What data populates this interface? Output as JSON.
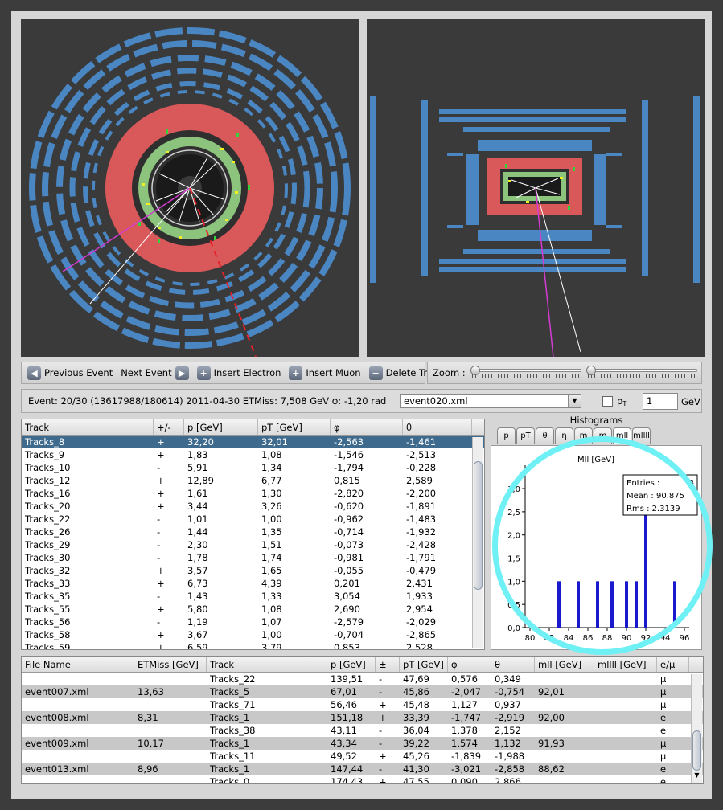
{
  "toolbar": {
    "prev_label": "Previous Event",
    "next_label": "Next Event",
    "insert_electron_label": "Insert Electron",
    "insert_muon_label": "Insert Muon",
    "delete_track_label": "Delete Track",
    "zoom_label": "Zoom :"
  },
  "info": {
    "event_text": "Event: 20/30 (13617988/180614)  2011-04-30   ETMiss: 7,508 GeV   φ: -1,20 rad",
    "selected_file": "event020.xml",
    "pt_label": "p",
    "pt_sub": "T",
    "pt_value": "1",
    "pt_unit": "GeV"
  },
  "tracks_table": {
    "headers": [
      "Track",
      "+/-",
      "p [GeV]",
      "pT [GeV]",
      "φ",
      "θ"
    ],
    "rows": [
      [
        "Tracks_8",
        "+",
        "32,20",
        "32,01",
        "-2,563",
        "-1,461"
      ],
      [
        "Tracks_9",
        "+",
        "1,83",
        "1,08",
        "-1,546",
        "-2,513"
      ],
      [
        "Tracks_10",
        "-",
        "5,91",
        "1,34",
        "-1,794",
        "-0,228"
      ],
      [
        "Tracks_12",
        "+",
        "12,89",
        "6,77",
        "0,815",
        "2,589"
      ],
      [
        "Tracks_16",
        "+",
        "1,61",
        "1,30",
        "-2,820",
        "-2,200"
      ],
      [
        "Tracks_20",
        "+",
        "3,44",
        "3,26",
        "-0,620",
        "-1,891"
      ],
      [
        "Tracks_22",
        "-",
        "1,01",
        "1,00",
        "-0,962",
        "-1,483"
      ],
      [
        "Tracks_26",
        "-",
        "1,44",
        "1,35",
        "-0,714",
        "-1,932"
      ],
      [
        "Tracks_29",
        "-",
        "2,30",
        "1,51",
        "-0,073",
        "-2,428"
      ],
      [
        "Tracks_30",
        "-",
        "1,78",
        "1,74",
        "-0,981",
        "-1,791"
      ],
      [
        "Tracks_32",
        "+",
        "3,57",
        "1,65",
        "-0,055",
        "-0,479"
      ],
      [
        "Tracks_33",
        "+",
        "6,73",
        "4,39",
        "0,201",
        "2,431"
      ],
      [
        "Tracks_35",
        "-",
        "1,43",
        "1,33",
        "3,054",
        "1,933"
      ],
      [
        "Tracks_55",
        "+",
        "5,80",
        "1,08",
        "2,690",
        "2,954"
      ],
      [
        "Tracks_56",
        "-",
        "1,19",
        "1,07",
        "-2,579",
        "-2,029"
      ],
      [
        "Tracks_58",
        "+",
        "3,67",
        "1,00",
        "-0,704",
        "-2,865"
      ],
      [
        "Tracks_59",
        "+",
        "6,59",
        "3,79",
        "0,853",
        "2,528"
      ]
    ]
  },
  "histograms": {
    "title": "Histograms",
    "tabs": [
      "p",
      "pT",
      "θ",
      "η",
      "m",
      "m",
      "mll",
      "mllll"
    ],
    "plot_title": "Mll [GeV]",
    "stats": {
      "entries_label": "Entries :",
      "entries_value": "8",
      "mean_label": "Mean :",
      "mean_value": "90.875",
      "rms_label": "Rms :",
      "rms_value": "2.3139"
    }
  },
  "chart_data": {
    "type": "bar",
    "title": "Mll [GeV]",
    "x": [
      83,
      85,
      87,
      88.5,
      90,
      91,
      92,
      95
    ],
    "values": [
      1,
      1,
      1,
      1,
      1,
      1,
      3,
      1
    ],
    "xlim": [
      79.5,
      96.5
    ],
    "ylim": [
      0,
      3.4
    ],
    "xticks": [
      "80",
      "82",
      "84",
      "86",
      "88",
      "90",
      "92",
      "94",
      "96"
    ],
    "yticks": [
      "0,0",
      "0,5",
      "1,0",
      "1,5",
      "2,0",
      "2,5",
      "3,0"
    ],
    "bar_color": "#1a1acc"
  },
  "summary_table": {
    "headers": [
      "File Name",
      "ETMiss [GeV]",
      "Track",
      "p [GeV]",
      "±",
      "pT [GeV]",
      "φ",
      "θ",
      "mll [GeV]",
      "mllll [GeV]",
      "e/μ"
    ],
    "rows": [
      [
        "",
        "",
        "Tracks_22",
        "139,51",
        "-",
        "47,69",
        "0,576",
        "0,349",
        "",
        "",
        "μ"
      ],
      [
        "event007.xml",
        "13,63",
        "Tracks_5",
        "67,01",
        "-",
        "45,86",
        "-2,047",
        "-0,754",
        "92,01",
        "",
        "μ"
      ],
      [
        "",
        "",
        "Tracks_71",
        "56,46",
        "+",
        "45,48",
        "1,127",
        "0,937",
        "",
        "",
        "μ"
      ],
      [
        "event008.xml",
        "8,31",
        "Tracks_1",
        "151,18",
        "+",
        "33,39",
        "-1,747",
        "-2,919",
        "92,00",
        "",
        "e"
      ],
      [
        "",
        "",
        "Tracks_38",
        "43,11",
        "-",
        "36,04",
        "1,378",
        "2,152",
        "",
        "",
        "e"
      ],
      [
        "event009.xml",
        "10,17",
        "Tracks_1",
        "43,34",
        "-",
        "39,22",
        "1,574",
        "1,132",
        "91,93",
        "",
        "μ"
      ],
      [
        "",
        "",
        "Tracks_11",
        "49,52",
        "+",
        "45,26",
        "-1,839",
        "-1,988",
        "",
        "",
        "μ"
      ],
      [
        "event013.xml",
        "8,96",
        "Tracks_1",
        "147,44",
        "-",
        "41,30",
        "-3,021",
        "-2,858",
        "88,62",
        "",
        "e"
      ],
      [
        "",
        "",
        "Tracks_0",
        "174,43",
        "+",
        "47,55",
        "0,090",
        "2,866",
        "",
        "",
        "e"
      ]
    ]
  }
}
